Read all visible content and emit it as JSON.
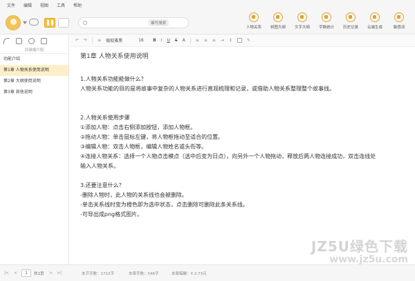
{
  "menu": [
    "文件",
    "编辑",
    "视图",
    "工具",
    "帮助"
  ],
  "toolbar": {
    "search_tag": "编写搜索",
    "tools": [
      {
        "label": "人物关系",
        "icon": "people-icon"
      },
      {
        "label": "树图大纲",
        "icon": "tree-icon"
      },
      {
        "label": "文字大纲",
        "icon": "outline-icon"
      },
      {
        "label": "字数统计",
        "icon": "count-icon"
      },
      {
        "label": "历史记录",
        "icon": "history-icon"
      },
      {
        "label": "云端生成",
        "icon": "cloud-gen-icon"
      },
      {
        "label": "敏感词",
        "icon": "sensitive-icon"
      }
    ]
  },
  "sidebar": {
    "subtitle": "目录缩介绍",
    "items": [
      {
        "label": "功能介绍",
        "active": false
      },
      {
        "label": "第1章 人物关系使用说明",
        "active": true
      },
      {
        "label": "第2章 大纲使用说明",
        "active": false
      },
      {
        "label": "第3章 其他说明",
        "active": false
      }
    ]
  },
  "format": {
    "font": "微软雅黑",
    "size": "16",
    "bold": "B",
    "italic": "I"
  },
  "document": {
    "title": "第1章 人物关系使用说明",
    "lines": [
      "1.人物关系功能能做什么？",
      "人物关系功能的目的是将故事中复杂的人物关系进行直观梳理和记录，或借助人物关系整理整个故事线。",
      "2.人物关系使用步骤",
      "①添加人物：点击右侧添加按钮，添加人物框。",
      "②拖动人物：单击鼠标左键，将人物框拖动至适合的位置。",
      "③编辑人物：双击人物框，编辑人物姓名或头衔等。",
      "④连接人物关系：选择一个人物点击模点（选中后变为日点），向另外一个人物拖动，释放后两人物连接成功，双击连线处",
      "输入人物关系。",
      "3.还要注意什么？",
      "-删除人物时，此人物的关系线也会被删除。",
      "-单击关系线时变为橙色即为选中状态，点击删除可删除此条关系线。",
      "-可导出成png格式图片。"
    ]
  },
  "bottom": {
    "prev": "|<",
    "page": "1",
    "total": "共1页",
    "next": ">|",
    "stats": [
      "本节字数：1722字",
      "本章字数：546字",
      "本章稿酬：¥ 2.73元"
    ]
  },
  "watermark": {
    "main": "JZ5U绿色下载",
    "url": "www.jz5u.com"
  }
}
